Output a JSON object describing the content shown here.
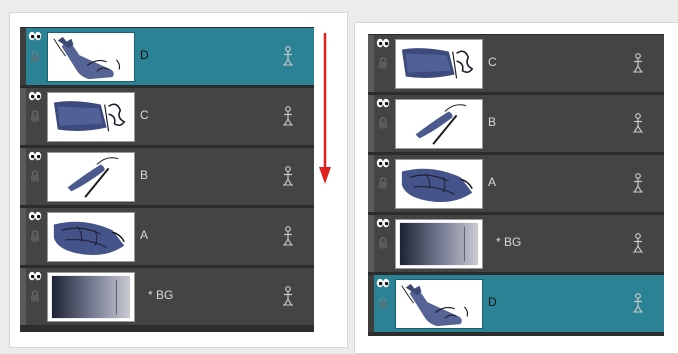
{
  "colors": {
    "selected_row": "#2a8294",
    "row": "#444444",
    "arrow": "#e02020"
  },
  "before_panel": {
    "layers": [
      {
        "name": "D",
        "selected": true
      },
      {
        "name": "C",
        "selected": false
      },
      {
        "name": "B",
        "selected": false
      },
      {
        "name": "A",
        "selected": false
      },
      {
        "name": "* BG",
        "selected": false
      }
    ]
  },
  "after_panel": {
    "layers": [
      {
        "name": "C",
        "selected": false
      },
      {
        "name": "B",
        "selected": false
      },
      {
        "name": "A",
        "selected": false
      },
      {
        "name": "* BG",
        "selected": false
      },
      {
        "name": "D",
        "selected": true
      }
    ]
  },
  "icons": {
    "visibility": "eye-icon",
    "lock": "lock-icon",
    "peg": "peg-icon",
    "move_direction": "arrow-down-icon"
  }
}
